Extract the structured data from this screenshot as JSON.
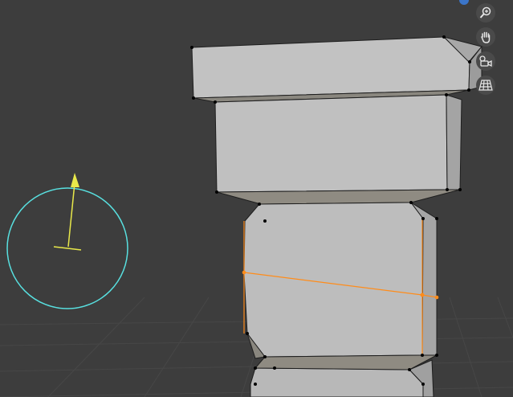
{
  "viewport": {
    "background": "#3d3d3d",
    "grid_color": "#4a4a4a"
  },
  "colors": {
    "mesh_face": "#bdbdbd",
    "mesh_face_shaded": "#a6a6a6",
    "mesh_bevel": "#8f8b82",
    "edge": "#1e1e1e",
    "vertex": "#000000",
    "selection": "#ff8c1a",
    "gizmo_circle": "#58e0e0",
    "gizmo_arrow": "#e8e84a"
  },
  "navigation": {
    "buttons": [
      {
        "icon": "zoom-icon"
      },
      {
        "icon": "pan-hand-icon"
      },
      {
        "icon": "camera-icon"
      },
      {
        "icon": "grid-perspective-icon"
      }
    ]
  }
}
